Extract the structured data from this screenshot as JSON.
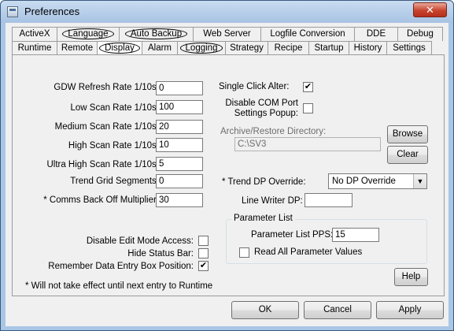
{
  "window": {
    "title": "Preferences",
    "close_label": "✕"
  },
  "tabs": {
    "row1": [
      {
        "label": "ActiveX",
        "circled": false
      },
      {
        "label": "Language",
        "circled": true
      },
      {
        "label": "Auto Backup",
        "circled": true
      },
      {
        "label": "Web Server",
        "circled": false
      },
      {
        "label": "Logfile Conversion",
        "circled": false
      },
      {
        "label": "DDE",
        "circled": false
      },
      {
        "label": "Debug",
        "circled": false
      }
    ],
    "row2": [
      {
        "label": "Runtime",
        "circled": false
      },
      {
        "label": "Remote",
        "circled": false
      },
      {
        "label": "Display",
        "circled": true,
        "active": true
      },
      {
        "label": "Alarm",
        "circled": false
      },
      {
        "label": "Logging",
        "circled": true
      },
      {
        "label": "Strategy",
        "circled": false
      },
      {
        "label": "Recipe",
        "circled": false
      },
      {
        "label": "Startup",
        "circled": false
      },
      {
        "label": "History",
        "circled": false
      },
      {
        "label": "Settings",
        "circled": false
      }
    ]
  },
  "rates": [
    {
      "label": "GDW Refresh Rate 1/10s:",
      "value": "0"
    },
    {
      "label": "Low Scan Rate 1/10s:",
      "value": "100"
    },
    {
      "label": "Medium Scan Rate 1/10s:",
      "value": "20"
    },
    {
      "label": "High Scan Rate 1/10s:",
      "value": "10"
    },
    {
      "label": "Ultra High Scan Rate 1/10s:",
      "value": "5"
    },
    {
      "label": "Trend Grid Segments:",
      "value": "0"
    },
    {
      "label": "* Comms Back Off Multiplier:",
      "value": "30"
    }
  ],
  "single_click_alter": {
    "label": "Single Click Alter:",
    "checked": true,
    "mark": "✔"
  },
  "disable_com_port": {
    "label_line1": "Disable COM Port",
    "label_line2": "Settings Popup:",
    "checked": false
  },
  "archive": {
    "label": "Archive/Restore Directory:",
    "value": "C:\\SV3",
    "browse_label": "Browse",
    "clear_label": "Clear"
  },
  "trend_dp": {
    "label": "* Trend DP Override:",
    "value": "No DP Override",
    "arrow": "▼"
  },
  "line_writer": {
    "label": "Line Writer DP:",
    "value": ""
  },
  "parameter_list": {
    "title": "Parameter List",
    "pps_label": "Parameter List PPS:",
    "pps_value": "15",
    "read_all_label": "Read All Parameter Values",
    "read_all_checked": false
  },
  "checkboxes": [
    {
      "label": "Disable Edit Mode Access:",
      "checked": false,
      "mark": ""
    },
    {
      "label": "Hide Status Bar:",
      "checked": false,
      "mark": ""
    },
    {
      "label": "Remember Data Entry Box Position:",
      "checked": true,
      "mark": "✔"
    }
  ],
  "footnote": "* Will not take effect until next entry to Runtime",
  "help_label": "Help",
  "buttons": {
    "ok": "OK",
    "cancel": "Cancel",
    "apply": "Apply"
  }
}
